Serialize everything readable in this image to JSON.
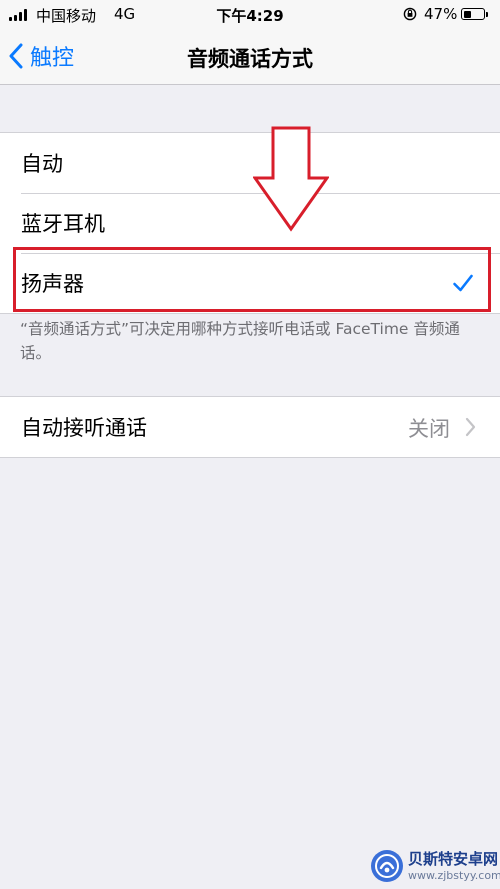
{
  "status_bar": {
    "carrier": "中国移动",
    "network": "4G",
    "time": "下午4:29",
    "battery_percent": "47%",
    "battery_level": 0.47
  },
  "nav": {
    "back_label": "触控",
    "title": "音频通话方式"
  },
  "audio_routing": {
    "options": [
      {
        "label": "自动",
        "selected": false
      },
      {
        "label": "蓝牙耳机",
        "selected": false
      },
      {
        "label": "扬声器",
        "selected": true
      }
    ],
    "footer": "“音频通话方式”可决定用哪种方式接听电话或 FaceTime 音频通话。"
  },
  "auto_answer": {
    "label": "自动接听通话",
    "value": "关闭"
  },
  "icons": {
    "back": "chevron-left-icon",
    "selected": "checkmark-icon",
    "disclosure": "chevron-right-icon",
    "orientation_lock": "orientation-lock-icon"
  },
  "colors": {
    "accent": "#0a7aff",
    "annotation_red": "#d81e2b",
    "background": "#efeff4"
  },
  "watermark": {
    "name": "贝斯特安卓网",
    "url": "www.zjbstyy.com"
  }
}
